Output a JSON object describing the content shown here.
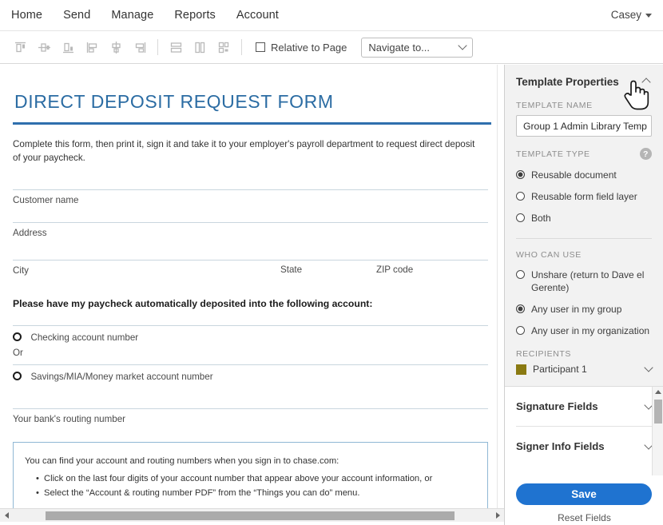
{
  "topnav": {
    "links": [
      {
        "label": "Home"
      },
      {
        "label": "Send"
      },
      {
        "label": "Manage"
      },
      {
        "label": "Reports"
      },
      {
        "label": "Account"
      }
    ],
    "user": "Casey"
  },
  "toolbar": {
    "icons": [
      {
        "name": "align-top-icon"
      },
      {
        "name": "align-middle-horizontal-icon"
      },
      {
        "name": "align-bottom-icon"
      },
      {
        "name": "align-left-icon"
      },
      {
        "name": "align-center-icon"
      },
      {
        "name": "align-right-icon"
      },
      {
        "name": "match-width-icon"
      },
      {
        "name": "match-height-icon"
      },
      {
        "name": "match-size-icon"
      }
    ],
    "relative_to_page": "Relative to Page",
    "relative_checked": false,
    "navigate_to": "Navigate to..."
  },
  "document": {
    "title": "DIRECT DEPOSIT REQUEST FORM",
    "intro": "Complete this form, then print it, sign it and take it to your employer's payroll department to request direct deposit of your paycheck.",
    "fields": [
      {
        "label": "Customer name"
      },
      {
        "label": "Address"
      }
    ],
    "city_row": {
      "city": "City",
      "state": "State",
      "zip": "ZIP code"
    },
    "question": "Please have my paycheck automatically deposited into the following account:",
    "options": [
      {
        "label": "Checking account number"
      },
      {
        "label": "Savings/MIA/Money market account number"
      }
    ],
    "or_text": "Or",
    "routing_label": "Your bank's routing number",
    "note": {
      "intro": "You can find your account and routing numbers when you sign in to chase.com:",
      "bullets": [
        "Click on the last four digits of your account number that appear above your account information, or",
        "Select the “Account & routing number PDF” from the “Things you can do” menu."
      ]
    }
  },
  "panel": {
    "header": "Template Properties",
    "template_name_label": "TEMPLATE NAME",
    "template_name_value": "Group 1 Admin Library Temp",
    "template_type_label": "TEMPLATE TYPE",
    "help_glyph": "?",
    "template_type_options": [
      {
        "label": "Reusable document",
        "selected": true
      },
      {
        "label": "Reusable form field layer",
        "selected": false
      },
      {
        "label": "Both",
        "selected": false
      }
    ],
    "who_can_use_label": "WHO CAN USE",
    "who_can_use_options": [
      {
        "label": "Unshare (return to Dave el Gerente)",
        "selected": false
      },
      {
        "label": "Any user in my group",
        "selected": true
      },
      {
        "label": "Any user in my organization",
        "selected": false
      }
    ],
    "recipients_label": "RECIPIENTS",
    "recipient": "Participant 1",
    "recipient_color": "#8a7a12",
    "accordions": [
      {
        "label": "Signature Fields"
      },
      {
        "label": "Signer Info Fields"
      }
    ],
    "save_label": "Save",
    "save_color": "#1f73d0",
    "reset_label": "Reset Fields"
  }
}
